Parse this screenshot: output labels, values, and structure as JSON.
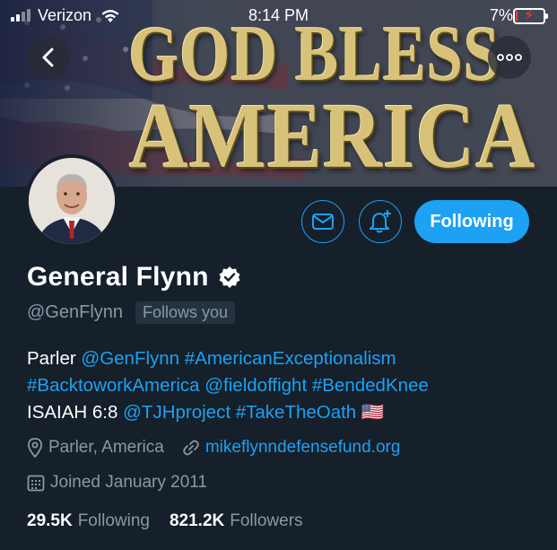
{
  "status_bar": {
    "carrier": "Verizon",
    "time": "8:14 PM",
    "battery_percent": "7%",
    "battery_level": 0.07
  },
  "banner": {
    "line1": "GOD BLESS",
    "line2": "AMERICA"
  },
  "actions": {
    "follow_label": "Following"
  },
  "profile": {
    "name": "General Flynn",
    "handle": "@GenFlynn",
    "follows_you": "Follows you",
    "bio": {
      "line1_prefix": "Parler ",
      "line1_link1": "@GenFlynn",
      "line1_link2": "#AmericanExceptionalism",
      "line2_link1": "#BacktoworkAmerica",
      "line2_link2": "@fieldoffight",
      "line2_link3": "#BendedKnee",
      "line3_prefix": "ISAIAH 6:8 ",
      "line3_link1": "@TJHproject",
      "line3_link2": "#TakeTheOath",
      "flag": "🇺🇸"
    },
    "location": "Parler, America",
    "website": "mikeflynndefensefund.org",
    "joined": "Joined January 2011",
    "following_count": "29.5K",
    "following_label": "Following",
    "followers_count": "821.2K",
    "followers_label": "Followers"
  },
  "colors": {
    "background": "#15202b",
    "accent": "#1da1f2",
    "secondary_text": "#8899a6"
  },
  "icons": [
    "signal-icon",
    "wifi-icon",
    "battery-icon",
    "back-icon",
    "more-icon",
    "mail-icon",
    "bell-plus-icon",
    "verified-icon",
    "location-icon",
    "link-icon",
    "calendar-icon"
  ]
}
